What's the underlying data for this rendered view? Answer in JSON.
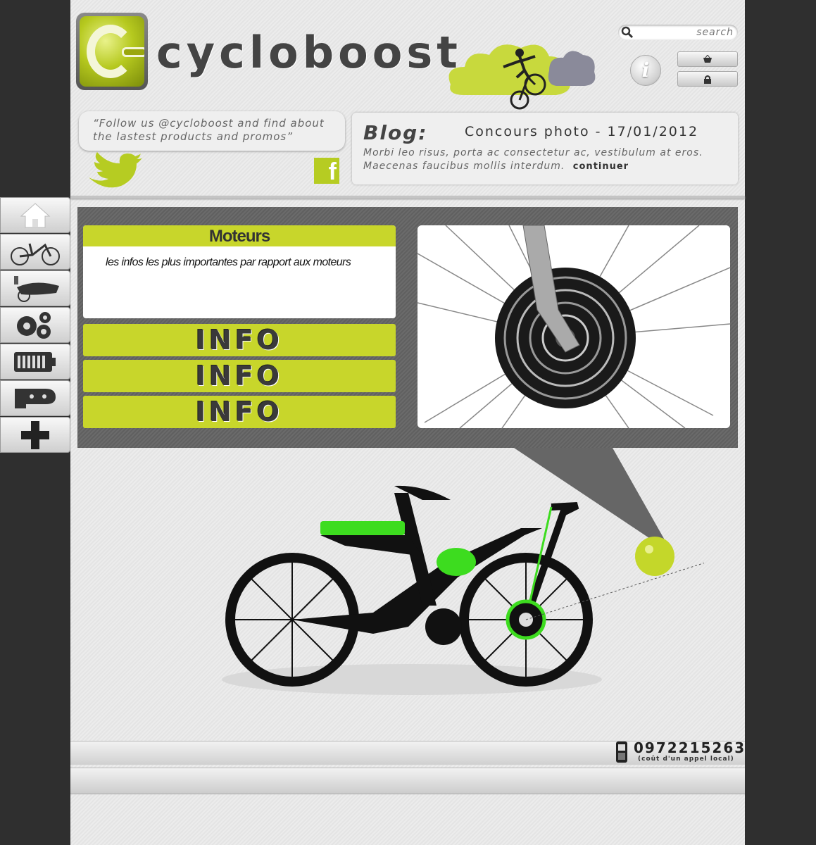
{
  "brand": {
    "name": "cycloboost"
  },
  "header": {
    "search_placeholder": "search",
    "info_label": "i"
  },
  "social": {
    "tweet": "“Follow us @cycloboost and find about the lastest products and promos”",
    "facebook_label": "f"
  },
  "blog": {
    "label": "Blog:",
    "title": "Concours photo - 17/01/2012",
    "excerpt": "Morbi leo risus, porta ac consectetur ac, vestibulum at eros. Maecenas faucibus mollis interdum.",
    "more": "continuer"
  },
  "sidebar": {
    "items": [
      {
        "icon": "home-icon"
      },
      {
        "icon": "bicycle-icon"
      },
      {
        "icon": "trailer-icon"
      },
      {
        "icon": "gears-icon"
      },
      {
        "icon": "battery-icon"
      },
      {
        "icon": "controller-icon"
      },
      {
        "icon": "plus-icon"
      }
    ]
  },
  "main": {
    "card_title": "Moteurs",
    "card_text": "les infos les plus importantes par rapport aux moteurs",
    "info_buttons": [
      "INFO",
      "INFO",
      "INFO"
    ]
  },
  "footer": {
    "phone": "0972215263",
    "phone_note": "(coût d'un appel local)"
  },
  "colors": {
    "accent": "#c8d62b",
    "bike_green": "#3ddc1f",
    "background": "#2f2f2f"
  }
}
